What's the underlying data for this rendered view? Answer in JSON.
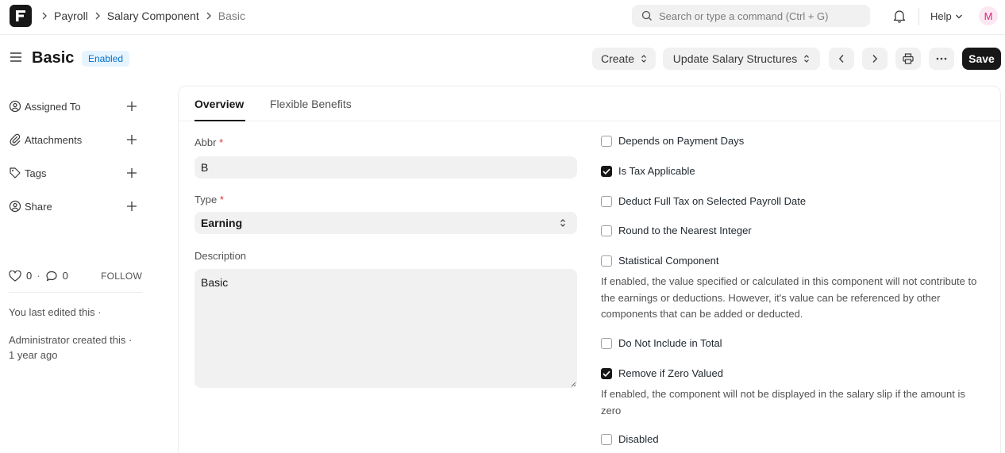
{
  "navbar": {
    "logo_letter": "F",
    "breadcrumbs": [
      "Payroll",
      "Salary Component",
      "Basic"
    ],
    "search_placeholder": "Search or type a command (Ctrl + G)",
    "help_label": "Help",
    "avatar_initial": "M"
  },
  "page": {
    "title": "Basic",
    "status": "Enabled",
    "buttons": {
      "create": "Create",
      "update": "Update Salary Structures",
      "save": "Save"
    }
  },
  "sidebar": {
    "items": [
      {
        "label": "Assigned To",
        "icon": "assign-icon"
      },
      {
        "label": "Attachments",
        "icon": "paperclip-icon"
      },
      {
        "label": "Tags",
        "icon": "tag-icon"
      },
      {
        "label": "Share",
        "icon": "share-icon"
      }
    ],
    "likes": "0",
    "comments": "0",
    "follow": "FOLLOW",
    "last_edited": "You last edited this ·",
    "created_by": "Administrator created this ·",
    "created_when": "1 year ago"
  },
  "tabs": [
    "Overview",
    "Flexible Benefits"
  ],
  "form": {
    "abbr": {
      "label": "Abbr",
      "value": "B"
    },
    "type": {
      "label": "Type",
      "value": "Earning"
    },
    "description": {
      "label": "Description",
      "value": "Basic"
    },
    "checks": [
      {
        "label": "Depends on Payment Days",
        "checked": false
      },
      {
        "label": "Is Tax Applicable",
        "checked": true
      },
      {
        "label": "Deduct Full Tax on Selected Payroll Date",
        "checked": false
      },
      {
        "label": "Round to the Nearest Integer",
        "checked": false
      },
      {
        "label": "Statistical Component",
        "checked": false
      },
      {
        "label": "Do Not Include in Total",
        "checked": false
      },
      {
        "label": "Remove if Zero Valued",
        "checked": true
      },
      {
        "label": "Disabled",
        "checked": false
      }
    ],
    "statistical_help": "If enabled, the value specified or calculated in this component will not contribute to the earnings or deductions. However, it's value can be referenced by other components that can be added or deducted.",
    "zero_help": "If enabled, the component will not be displayed in the salary slip if the amount is zero"
  },
  "colors": {
    "primary": "#171717",
    "indicator_bg": "#e6f4ff",
    "indicator_text": "#0070cc",
    "required": "#e03636"
  }
}
